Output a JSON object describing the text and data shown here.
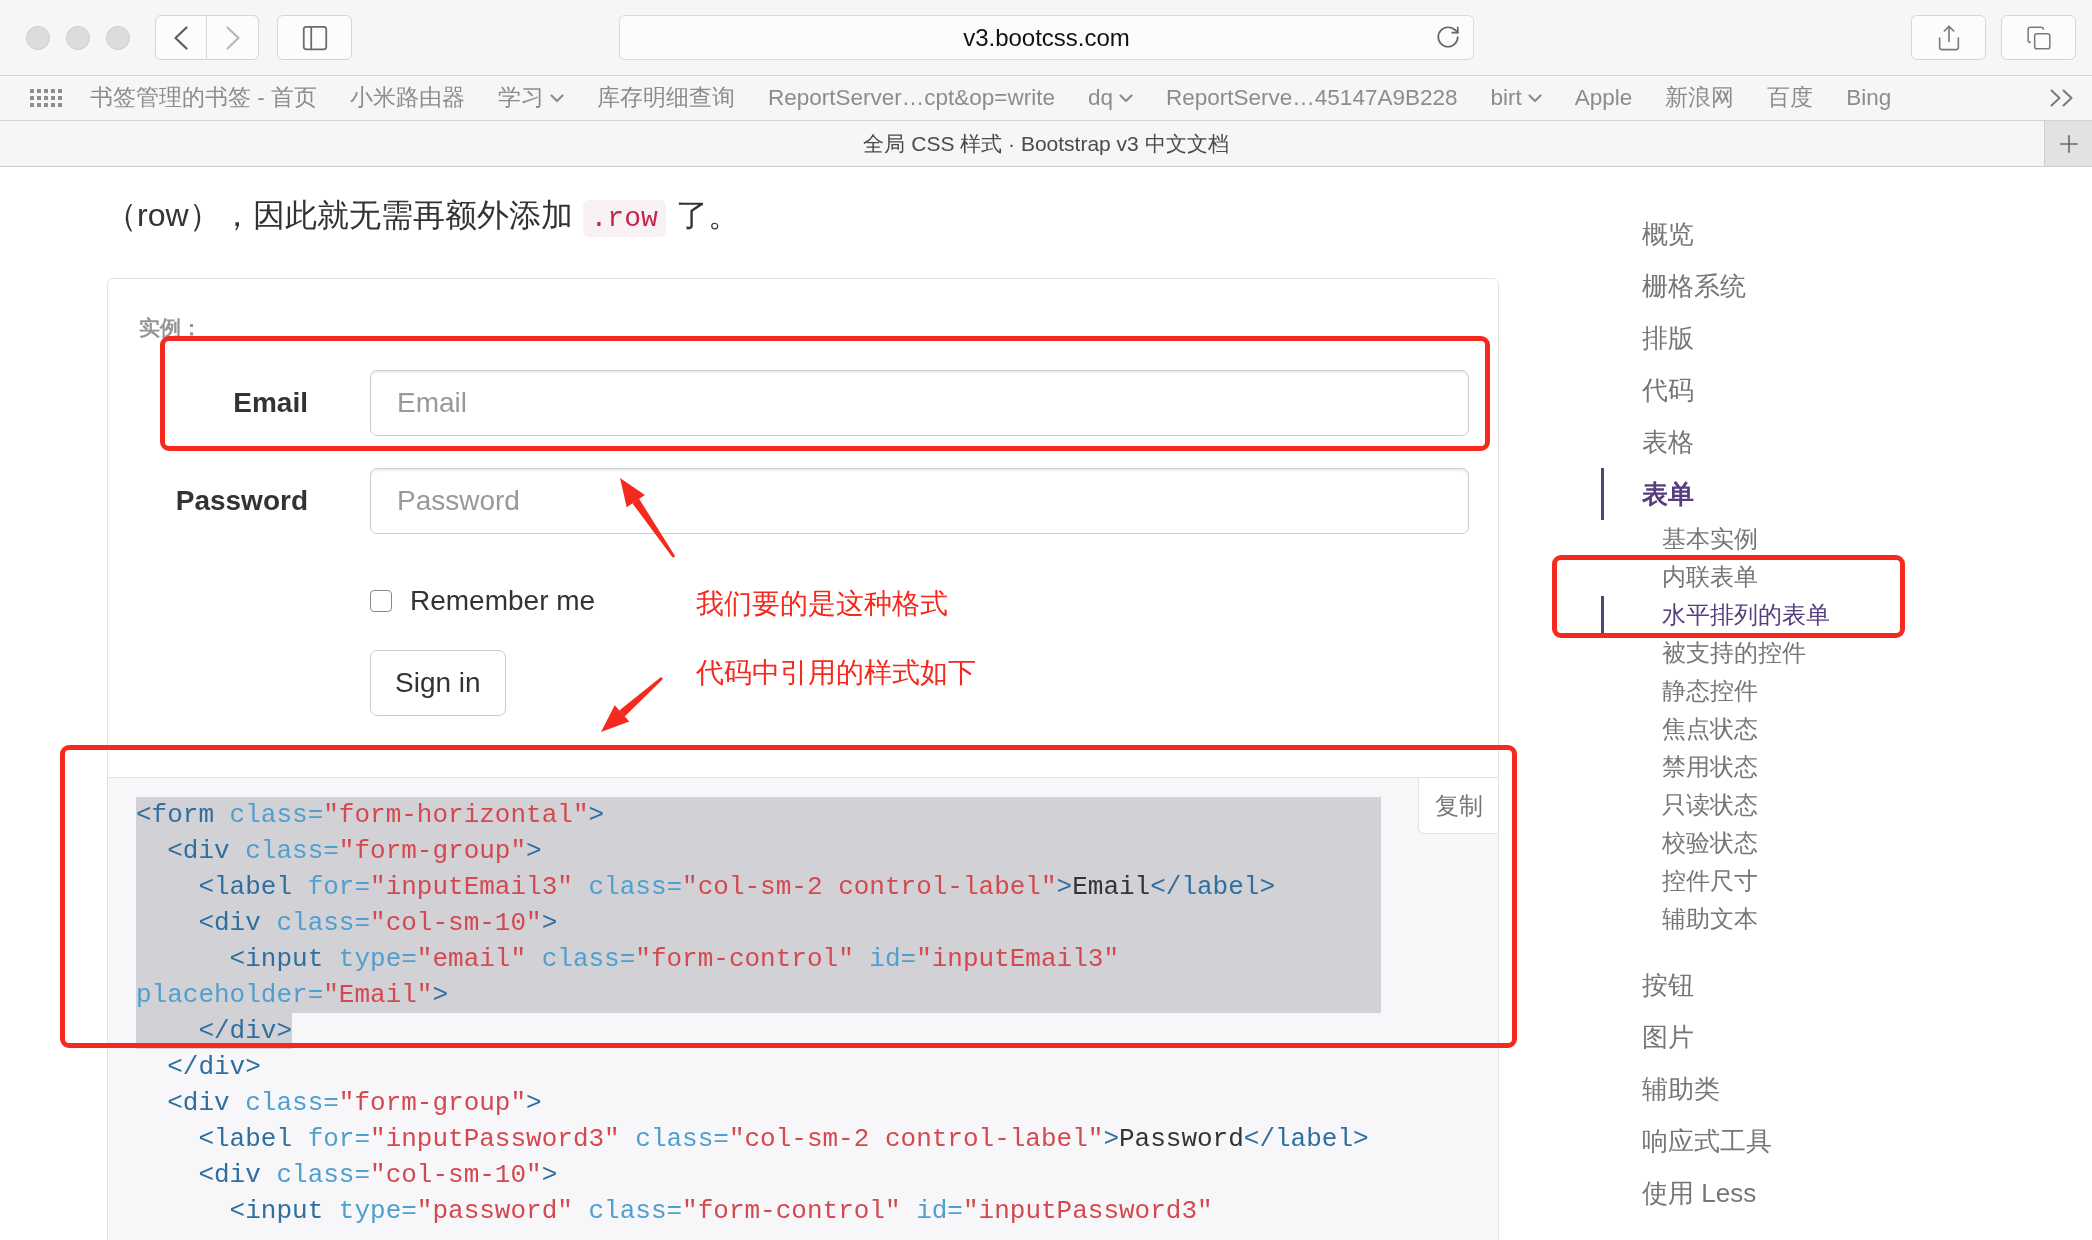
{
  "browser": {
    "nav": {
      "back_disabled": false,
      "forward_disabled": true
    },
    "url": "v3.bootcss.com",
    "bookmarks": [
      {
        "label": "书签管理的书签 - 首页",
        "folder": false
      },
      {
        "label": "小米路由器",
        "folder": false
      },
      {
        "label": "学习",
        "folder": true
      },
      {
        "label": "库存明细查询",
        "folder": false
      },
      {
        "label": "ReportServer…cpt&op=write",
        "folder": false
      },
      {
        "label": "dq",
        "folder": true
      },
      {
        "label": "ReportServe…45147A9B228",
        "folder": false
      },
      {
        "label": "birt",
        "folder": true
      },
      {
        "label": "Apple",
        "folder": false
      },
      {
        "label": "新浪网",
        "folder": false
      },
      {
        "label": "百度",
        "folder": false
      },
      {
        "label": "Bing",
        "folder": false
      }
    ],
    "tab_title": "全局 CSS 样式 · Bootstrap v3 中文文档"
  },
  "article": {
    "paragraph": [
      {
        "kind": "text",
        "text": "（row），因此就无需再额外添加"
      },
      {
        "kind": "code",
        "text": ".row"
      },
      {
        "kind": "text",
        "text": "了。"
      }
    ]
  },
  "example": {
    "label": "实例：",
    "fields": [
      {
        "label": "Email",
        "placeholder": "Email"
      },
      {
        "label": "Password",
        "placeholder": "Password"
      }
    ],
    "remember": {
      "label": "Remember me",
      "checked": false
    },
    "submit": "Sign in"
  },
  "notes": [
    "我们要的是这种格式",
    "代码中引用的样式如下"
  ],
  "code": {
    "copy_label": "复制",
    "lines": [
      {
        "selected": true,
        "tokens": [
          {
            "kind": "tag",
            "text": "<form"
          },
          {
            "kind": "attr",
            "text": " class="
          },
          {
            "kind": "string",
            "text": "\"form-horizontal\""
          },
          {
            "kind": "tag",
            "text": ">"
          }
        ]
      },
      {
        "selected": true,
        "tokens": [
          {
            "kind": "tag",
            "text": "  <div"
          },
          {
            "kind": "attr",
            "text": " class="
          },
          {
            "kind": "string",
            "text": "\"form-group\""
          },
          {
            "kind": "tag",
            "text": ">"
          }
        ]
      },
      {
        "selected": true,
        "tokens": [
          {
            "kind": "tag",
            "text": "    <label"
          },
          {
            "kind": "attr",
            "text": " for="
          },
          {
            "kind": "string",
            "text": "\"inputEmail3\""
          },
          {
            "kind": "attr",
            "text": " class="
          },
          {
            "kind": "string",
            "text": "\"col-sm-2 control-label\""
          },
          {
            "kind": "tag",
            "text": ">"
          },
          {
            "kind": "text",
            "text": "Email"
          },
          {
            "kind": "tag",
            "text": "</label>"
          }
        ]
      },
      {
        "selected": true,
        "tokens": [
          {
            "kind": "tag",
            "text": "    <div"
          },
          {
            "kind": "attr",
            "text": " class="
          },
          {
            "kind": "string",
            "text": "\"col-sm-10\""
          },
          {
            "kind": "tag",
            "text": ">"
          }
        ]
      },
      {
        "selected": true,
        "tokens": [
          {
            "kind": "tag",
            "text": "      <input"
          },
          {
            "kind": "attr",
            "text": " type="
          },
          {
            "kind": "string",
            "text": "\"email\""
          },
          {
            "kind": "attr",
            "text": " class="
          },
          {
            "kind": "string",
            "text": "\"form-control\""
          },
          {
            "kind": "attr",
            "text": " id="
          },
          {
            "kind": "string",
            "text": "\"inputEmail3\""
          }
        ]
      },
      {
        "selected": true,
        "tokens": [
          {
            "kind": "attr",
            "text": "placeholder="
          },
          {
            "kind": "string",
            "text": "\"Email\""
          },
          {
            "kind": "tag",
            "text": ">"
          }
        ]
      },
      {
        "selected": true,
        "tokens": [
          {
            "kind": "tag",
            "text": "    </div>"
          }
        ]
      },
      {
        "selected": false,
        "tokens": [
          {
            "kind": "tag",
            "text": "  </div>"
          }
        ]
      },
      {
        "selected": false,
        "tokens": [
          {
            "kind": "tag",
            "text": "  <div"
          },
          {
            "kind": "attr",
            "text": " class="
          },
          {
            "kind": "string",
            "text": "\"form-group\""
          },
          {
            "kind": "tag",
            "text": ">"
          }
        ]
      },
      {
        "selected": false,
        "tokens": [
          {
            "kind": "tag",
            "text": "    <label"
          },
          {
            "kind": "attr",
            "text": " for="
          },
          {
            "kind": "string",
            "text": "\"inputPassword3\""
          },
          {
            "kind": "attr",
            "text": " class="
          },
          {
            "kind": "string",
            "text": "\"col-sm-2 control-label\""
          },
          {
            "kind": "tag",
            "text": ">"
          },
          {
            "kind": "text",
            "text": "Password"
          },
          {
            "kind": "tag",
            "text": "</label>"
          }
        ]
      },
      {
        "selected": false,
        "tokens": [
          {
            "kind": "tag",
            "text": "    <div"
          },
          {
            "kind": "attr",
            "text": " class="
          },
          {
            "kind": "string",
            "text": "\"col-sm-10\""
          },
          {
            "kind": "tag",
            "text": ">"
          }
        ]
      },
      {
        "selected": false,
        "tokens": [
          {
            "kind": "tag",
            "text": "      <input"
          },
          {
            "kind": "attr",
            "text": " type="
          },
          {
            "kind": "string",
            "text": "\"password\""
          },
          {
            "kind": "attr",
            "text": " class="
          },
          {
            "kind": "string",
            "text": "\"form-control\""
          },
          {
            "kind": "attr",
            "text": " id="
          },
          {
            "kind": "string",
            "text": "\"inputPassword3\""
          }
        ]
      }
    ]
  },
  "sidebar": {
    "items": [
      {
        "label": "概览",
        "selected": false
      },
      {
        "label": "栅格系统",
        "selected": false
      },
      {
        "label": "排版",
        "selected": false
      },
      {
        "label": "代码",
        "selected": false
      },
      {
        "label": "表格",
        "selected": false
      },
      {
        "label": "表单",
        "selected": true,
        "children": [
          {
            "label": "基本实例",
            "selected": false
          },
          {
            "label": "内联表单",
            "selected": false
          },
          {
            "label": "水平排列的表单",
            "selected": true
          },
          {
            "label": "被支持的控件",
            "selected": false
          },
          {
            "label": "静态控件",
            "selected": false
          },
          {
            "label": "焦点状态",
            "selected": false
          },
          {
            "label": "禁用状态",
            "selected": false
          },
          {
            "label": "只读状态",
            "selected": false
          },
          {
            "label": "校验状态",
            "selected": false
          },
          {
            "label": "控件尺寸",
            "selected": false
          },
          {
            "label": "辅助文本",
            "selected": false
          }
        ]
      },
      {
        "label": "按钮",
        "selected": false
      },
      {
        "label": "图片",
        "selected": false
      },
      {
        "label": "辅助类",
        "selected": false
      },
      {
        "label": "响应式工具",
        "selected": false
      },
      {
        "label": "使用 Less",
        "selected": false
      }
    ]
  }
}
